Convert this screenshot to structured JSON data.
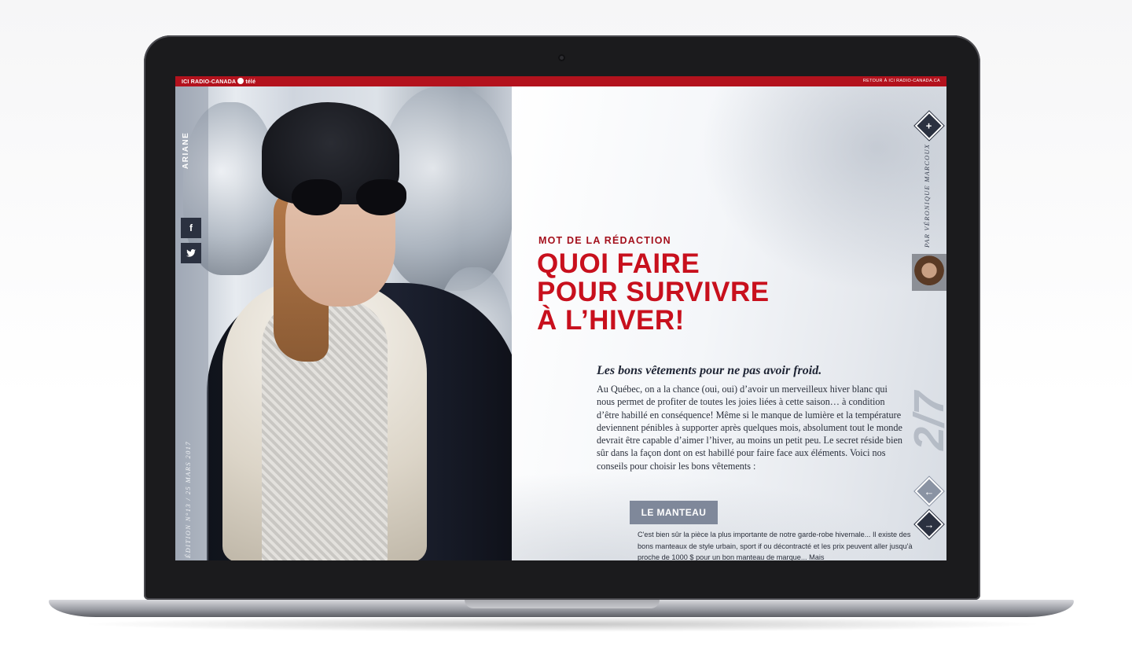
{
  "topbar": {
    "brand_ici": "ICI RADIO-CANADA",
    "brand_tele": "télé",
    "back_link": "RETOUR À ICI RADIO-CANADA.CA"
  },
  "sidebar": {
    "author": "ARIANE",
    "share_facebook": "f",
    "share_twitter": "t",
    "edition": "ÉDITION N°13  /  25 MARS 2017"
  },
  "article": {
    "kicker": "MOT DE LA RÉDACTION",
    "headline_lines": [
      "QUOI FAIRE",
      "POUR SURVIVRE",
      "À L’HIVER!"
    ],
    "lead_title": "Les bons vêtements pour ne pas avoir froid.",
    "lead_body": "Au Québec, on a la chance (oui, oui) d’avoir un merveilleux hiver blanc qui nous permet de profiter de toutes les joies liées à cette saison… à condition d’être habillé en conséquence! Même si le manque de lumière et la température deviennent pénibles à supporter après quelques mois, absolument tout le monde devrait être capable d’aimer l’hiver, au moins un petit peu. Le secret réside bien sûr dans la façon dont on est habillé pour faire face aux éléments. Voici nos conseils pour choisir les bons vêtements :",
    "section_button": "LE MANTEAU",
    "section_body": "C'est bien sûr la pièce la plus importante de notre garde-robe hivernale... Il existe des bons manteaux de style urbain, sport if ou décontracté et les prix peuvent aller jusqu'à proche de 1000 $ pour un bon manteau de marque... Mais"
  },
  "rail": {
    "byline": "PAR VÉRONIQUE MARCOUX",
    "page_number": "2/7",
    "plus_symbol": "+",
    "prev_symbol": "←",
    "next_symbol": "→"
  },
  "colors": {
    "brand_red": "#b3121d",
    "headline_red": "#c8101d",
    "navy": "#2b3140",
    "slate": "#7f889a"
  },
  "icons": [
    "facebook-icon",
    "twitter-icon",
    "plus-icon",
    "arrow-left-icon",
    "arrow-right-icon",
    "radio-canada-gem-icon"
  ]
}
